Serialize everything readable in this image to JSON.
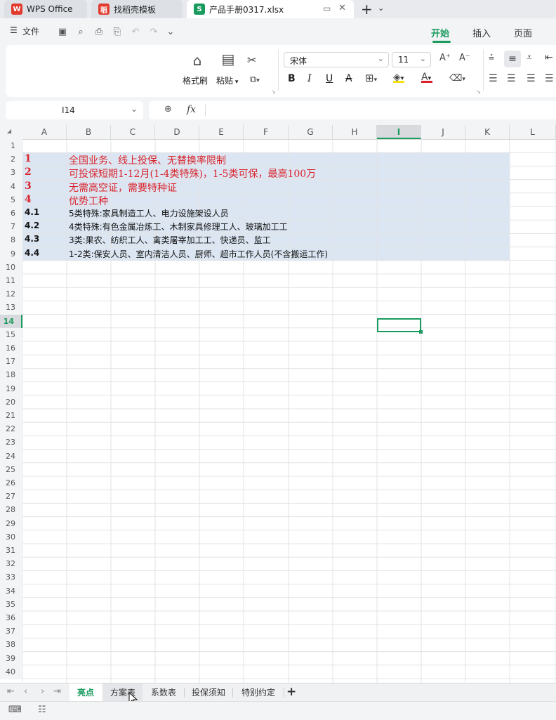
{
  "tabs": [
    {
      "label": "WPS Office",
      "icon": "wps-logo-icon"
    },
    {
      "label": "找稻壳模板",
      "icon": "docer-icon"
    },
    {
      "label": "产品手册0317.xlsx",
      "icon": "spreadsheet-icon"
    }
  ],
  "menu": {
    "file_label": "文件"
  },
  "ribbon_tabs": [
    "开始",
    "插入",
    "页面"
  ],
  "ribbon": {
    "format_painter": "格式刷",
    "paste": "粘贴",
    "font_name": "宋体",
    "font_size": "11"
  },
  "formula_bar": {
    "cell_ref": "I14",
    "fx": "fx",
    "formula": ""
  },
  "columns": [
    "A",
    "B",
    "C",
    "D",
    "E",
    "F",
    "G",
    "H",
    "I",
    "J",
    "K",
    "L"
  ],
  "selected_column": "I",
  "selected_row": "14",
  "rows": [
    "1",
    "2",
    "3",
    "4",
    "5",
    "6",
    "7",
    "8",
    "9",
    "10",
    "11",
    "12",
    "13",
    "14",
    "15",
    "16",
    "17",
    "18",
    "19",
    "20",
    "21",
    "22",
    "23",
    "24",
    "25",
    "26",
    "27",
    "28",
    "29",
    "30",
    "31",
    "32",
    "33",
    "34",
    "35",
    "36",
    "37",
    "38",
    "39",
    "40"
  ],
  "cells": [
    {
      "row": 2,
      "a": "1",
      "b": "全国业务、线上投保、无替换率限制",
      "style": "red"
    },
    {
      "row": 3,
      "a": "2",
      "b": "可投保短期1-12月(1-4类特殊)，1-5类可保，最高100万",
      "style": "red"
    },
    {
      "row": 4,
      "a": "3",
      "b": "无需高空证，需要特种证",
      "style": "red"
    },
    {
      "row": 5,
      "a": "4",
      "b": "优势工种",
      "style": "red"
    },
    {
      "row": 6,
      "a": "4.1",
      "b": "5类特殊:家具制造工人、电力设施架设人员",
      "style": "blk"
    },
    {
      "row": 7,
      "a": "4.2",
      "b": "4类特殊:有色金属冶炼工、木制家具修理工人、玻璃加工工",
      "style": "blk"
    },
    {
      "row": 8,
      "a": "4.3",
      "b": "3类:果农、纺织工人、禽类屠宰加工工、快递员、监工",
      "style": "blk"
    },
    {
      "row": 9,
      "a": "4.4",
      "b": "1-2类:保安人员、室内清洁人员、厨师、超市工作人员(不含搬运工作)",
      "style": "blk"
    }
  ],
  "sheets": [
    "亮点",
    "方案表",
    "系数表",
    "投保须知",
    "特别约定"
  ],
  "active_sheet": "亮点",
  "colors": {
    "accent": "#1a9b5e",
    "red_text": "#d9242c",
    "highlight": "#dce6f2"
  }
}
